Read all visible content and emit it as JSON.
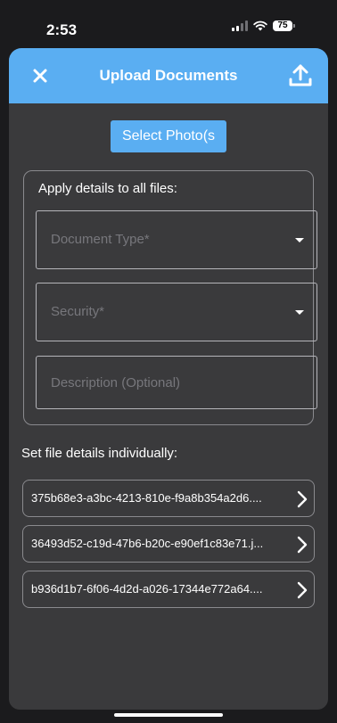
{
  "status_bar": {
    "time": "2:53",
    "battery": "75"
  },
  "header": {
    "title": "Upload Documents",
    "close_icon": "close-icon",
    "upload_icon": "upload-icon"
  },
  "select_button": {
    "label": "Select Photo(s"
  },
  "apply_all": {
    "heading": "Apply details to all files:",
    "document_type_placeholder": "Document Type*",
    "security_placeholder": "Security*",
    "description_placeholder": "Description (Optional)"
  },
  "individual": {
    "heading": "Set file details individually:",
    "files": [
      "375b68e3-a3bc-4213-810e-f9a8b354a2d6....",
      "36493d52-c19d-47b6-b20c-e90ef1c83e71.j...",
      "b936d1b7-6f06-4d2d-a026-17344e772a64...."
    ]
  },
  "colors": {
    "accent": "#5aaef2",
    "sheet_background": "#3a3a3c",
    "page_background": "#1b1b1d",
    "placeholder": "#77777c"
  }
}
